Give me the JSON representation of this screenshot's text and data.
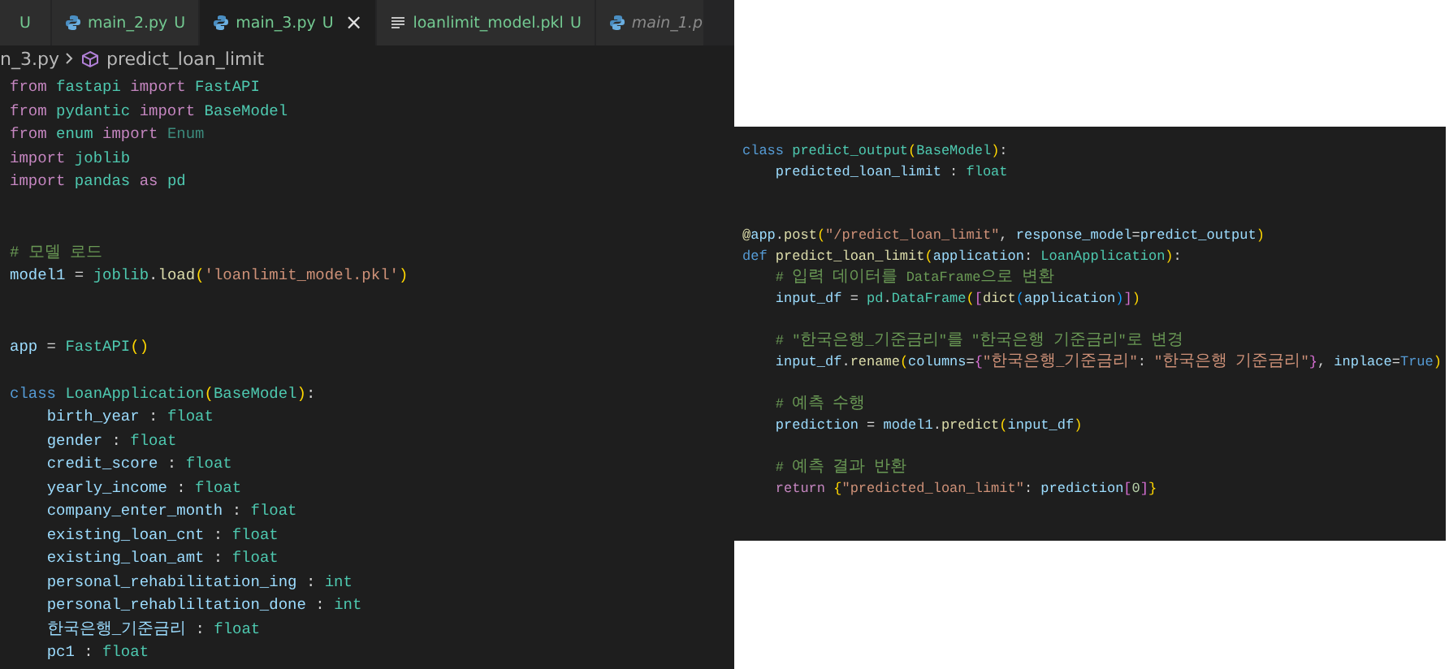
{
  "editor": {
    "tabs": [
      {
        "kind": "partial",
        "badge": "U",
        "selected": false,
        "preview": false
      },
      {
        "kind": "python",
        "label": "main_2.py",
        "badge": "U",
        "selected": false,
        "preview": false
      },
      {
        "kind": "python",
        "label": "main_3.py",
        "badge": "U",
        "selected": true,
        "preview": false,
        "close": "×"
      },
      {
        "kind": "file",
        "label": "loanlimit_model.pkl",
        "badge": "U",
        "selected": false,
        "preview": false
      },
      {
        "kind": "python",
        "label": "main_1.p",
        "selected": false,
        "preview": true
      }
    ],
    "breadcrumb": {
      "file": "n_3.py",
      "symbol": "predict_loan_limit"
    },
    "lines": [
      {
        "tokens": [
          {
            "kind": "kw",
            "text": "from "
          },
          {
            "kind": "mod",
            "text": "fastapi "
          },
          {
            "kind": "kw",
            "text": "import "
          },
          {
            "kind": "cls",
            "text": "FastAPI"
          }
        ]
      },
      {
        "tokens": [
          {
            "kind": "kw",
            "text": "from "
          },
          {
            "kind": "mod",
            "text": "pydantic "
          },
          {
            "kind": "kw",
            "text": "import "
          },
          {
            "kind": "cls",
            "text": "BaseModel"
          }
        ]
      },
      {
        "tokens": [
          {
            "kind": "kw",
            "text": "from "
          },
          {
            "kind": "mod",
            "text": "enum "
          },
          {
            "kind": "kw",
            "text": "import "
          },
          {
            "kind": "dim",
            "text": "Enum"
          }
        ]
      },
      {
        "tokens": [
          {
            "kind": "kw",
            "text": "import "
          },
          {
            "kind": "mod",
            "text": "joblib"
          }
        ]
      },
      {
        "tokens": [
          {
            "kind": "kw",
            "text": "import "
          },
          {
            "kind": "mod",
            "text": "pandas "
          },
          {
            "kind": "kw",
            "text": "as "
          },
          {
            "kind": "mod",
            "text": "pd"
          }
        ]
      },
      {
        "kind": "blank"
      },
      {
        "kind": "blank"
      },
      {
        "tokens": [
          {
            "kind": "com",
            "text": "# 모델 로드"
          }
        ]
      },
      {
        "tokens": [
          {
            "kind": "var",
            "text": "model1"
          },
          {
            "kind": "plain",
            "text": " = "
          },
          {
            "kind": "mod",
            "text": "joblib"
          },
          {
            "kind": "plain",
            "text": "."
          },
          {
            "kind": "fn",
            "text": "load"
          },
          {
            "kind": "p1",
            "text": "("
          },
          {
            "kind": "str",
            "text": "'loanlimit_model.pkl'"
          },
          {
            "kind": "p1",
            "text": ")"
          }
        ]
      },
      {
        "kind": "blank"
      },
      {
        "kind": "blank"
      },
      {
        "tokens": [
          {
            "kind": "var",
            "text": "app"
          },
          {
            "kind": "plain",
            "text": " = "
          },
          {
            "kind": "cls",
            "text": "FastAPI"
          },
          {
            "kind": "p1",
            "text": "()"
          }
        ]
      },
      {
        "kind": "blank"
      },
      {
        "tokens": [
          {
            "kind": "const",
            "text": "class "
          },
          {
            "kind": "cls",
            "text": "LoanApplication"
          },
          {
            "kind": "p1",
            "text": "("
          },
          {
            "kind": "cls",
            "text": "BaseModel"
          },
          {
            "kind": "p1",
            "text": ")"
          },
          {
            "kind": "plain",
            "text": ":"
          }
        ]
      },
      {
        "tokens": [
          {
            "kind": "var",
            "text": "    birth_year"
          },
          {
            "kind": "plain",
            "text": " : "
          },
          {
            "kind": "cls",
            "text": "float"
          }
        ]
      },
      {
        "tokens": [
          {
            "kind": "var",
            "text": "    gender"
          },
          {
            "kind": "plain",
            "text": " : "
          },
          {
            "kind": "cls",
            "text": "float"
          }
        ]
      },
      {
        "tokens": [
          {
            "kind": "var",
            "text": "    credit_score"
          },
          {
            "kind": "plain",
            "text": " : "
          },
          {
            "kind": "cls",
            "text": "float"
          }
        ]
      },
      {
        "tokens": [
          {
            "kind": "var",
            "text": "    yearly_income"
          },
          {
            "kind": "plain",
            "text": " : "
          },
          {
            "kind": "cls",
            "text": "float"
          }
        ]
      },
      {
        "tokens": [
          {
            "kind": "var",
            "text": "    company_enter_month"
          },
          {
            "kind": "plain",
            "text": " : "
          },
          {
            "kind": "cls",
            "text": "float"
          }
        ]
      },
      {
        "tokens": [
          {
            "kind": "var",
            "text": "    existing_loan_cnt"
          },
          {
            "kind": "plain",
            "text": " : "
          },
          {
            "kind": "cls",
            "text": "float"
          }
        ]
      },
      {
        "tokens": [
          {
            "kind": "var",
            "text": "    existing_loan_amt"
          },
          {
            "kind": "plain",
            "text": " : "
          },
          {
            "kind": "cls",
            "text": "float"
          }
        ]
      },
      {
        "tokens": [
          {
            "kind": "var",
            "text": "    personal_rehabilitation_ing"
          },
          {
            "kind": "plain",
            "text": " : "
          },
          {
            "kind": "cls",
            "text": "int"
          }
        ]
      },
      {
        "tokens": [
          {
            "kind": "var",
            "text": "    personal_rehabliltation_done"
          },
          {
            "kind": "plain",
            "text": " : "
          },
          {
            "kind": "cls",
            "text": "int"
          }
        ]
      },
      {
        "tokens": [
          {
            "kind": "var",
            "text": "    한국은행_기준금리"
          },
          {
            "kind": "plain",
            "text": " : "
          },
          {
            "kind": "cls",
            "text": "float"
          }
        ]
      },
      {
        "tokens": [
          {
            "kind": "var",
            "text": "    pc1"
          },
          {
            "kind": "plain",
            "text": " : "
          },
          {
            "kind": "cls",
            "text": "float"
          }
        ]
      }
    ]
  },
  "snippet": {
    "lines": [
      {
        "tokens": [
          {
            "kind": "const",
            "text": "class "
          },
          {
            "kind": "cls",
            "text": "predict_output"
          },
          {
            "kind": "p1",
            "text": "("
          },
          {
            "kind": "cls",
            "text": "BaseModel"
          },
          {
            "kind": "p1",
            "text": ")"
          },
          {
            "kind": "plain",
            "text": ":"
          }
        ]
      },
      {
        "tokens": [
          {
            "kind": "var",
            "text": "    predicted_loan_limit"
          },
          {
            "kind": "plain",
            "text": " : "
          },
          {
            "kind": "cls",
            "text": "float"
          }
        ]
      },
      {
        "kind": "blank"
      },
      {
        "kind": "blank"
      },
      {
        "tokens": [
          {
            "kind": "fn",
            "text": "@"
          },
          {
            "kind": "var",
            "text": "app"
          },
          {
            "kind": "plain",
            "text": "."
          },
          {
            "kind": "fn",
            "text": "post"
          },
          {
            "kind": "p1",
            "text": "("
          },
          {
            "kind": "str",
            "text": "\"/predict_loan_limit\""
          },
          {
            "kind": "plain",
            "text": ", "
          },
          {
            "kind": "var",
            "text": "response_model"
          },
          {
            "kind": "plain",
            "text": "="
          },
          {
            "kind": "var",
            "text": "predict_output"
          },
          {
            "kind": "p1",
            "text": ")"
          }
        ]
      },
      {
        "tokens": [
          {
            "kind": "const",
            "text": "def "
          },
          {
            "kind": "fn",
            "text": "predict_loan_limit"
          },
          {
            "kind": "p1",
            "text": "("
          },
          {
            "kind": "var",
            "text": "application"
          },
          {
            "kind": "plain",
            "text": ": "
          },
          {
            "kind": "cls",
            "text": "LoanApplication"
          },
          {
            "kind": "p1",
            "text": ")"
          },
          {
            "kind": "plain",
            "text": ":"
          }
        ]
      },
      {
        "tokens": [
          {
            "kind": "com",
            "text": "    # 입력 데이터를 DataFrame으로 변환"
          }
        ]
      },
      {
        "tokens": [
          {
            "kind": "var",
            "text": "    input_df"
          },
          {
            "kind": "plain",
            "text": " = "
          },
          {
            "kind": "mod",
            "text": "pd"
          },
          {
            "kind": "plain",
            "text": "."
          },
          {
            "kind": "cls",
            "text": "DataFrame"
          },
          {
            "kind": "p1",
            "text": "("
          },
          {
            "kind": "p2",
            "text": "["
          },
          {
            "kind": "fn",
            "text": "dict"
          },
          {
            "kind": "p3",
            "text": "("
          },
          {
            "kind": "var",
            "text": "application"
          },
          {
            "kind": "p3",
            "text": ")"
          },
          {
            "kind": "p2",
            "text": "]"
          },
          {
            "kind": "p1",
            "text": ")"
          }
        ]
      },
      {
        "kind": "blank"
      },
      {
        "tokens": [
          {
            "kind": "com",
            "text": "    # \"한국은행_기준금리\"를 \"한국은행 기준금리\"로 변경"
          }
        ]
      },
      {
        "tokens": [
          {
            "kind": "var",
            "text": "    input_df"
          },
          {
            "kind": "plain",
            "text": "."
          },
          {
            "kind": "fn",
            "text": "rename"
          },
          {
            "kind": "p1",
            "text": "("
          },
          {
            "kind": "var",
            "text": "columns"
          },
          {
            "kind": "plain",
            "text": "="
          },
          {
            "kind": "p2",
            "text": "{"
          },
          {
            "kind": "str",
            "text": "\"한국은행_기준금리\""
          },
          {
            "kind": "plain",
            "text": ": "
          },
          {
            "kind": "str",
            "text": "\"한국은행 기준금리\""
          },
          {
            "kind": "p2",
            "text": "}"
          },
          {
            "kind": "plain",
            "text": ", "
          },
          {
            "kind": "var",
            "text": "inplace"
          },
          {
            "kind": "plain",
            "text": "="
          },
          {
            "kind": "const",
            "text": "True"
          },
          {
            "kind": "p1",
            "text": ")"
          }
        ]
      },
      {
        "kind": "blank"
      },
      {
        "tokens": [
          {
            "kind": "com",
            "text": "    # 예측 수행"
          }
        ]
      },
      {
        "tokens": [
          {
            "kind": "var",
            "text": "    prediction"
          },
          {
            "kind": "plain",
            "text": " = "
          },
          {
            "kind": "var",
            "text": "model1"
          },
          {
            "kind": "plain",
            "text": "."
          },
          {
            "kind": "fn",
            "text": "predict"
          },
          {
            "kind": "p1",
            "text": "("
          },
          {
            "kind": "var",
            "text": "input_df"
          },
          {
            "kind": "p1",
            "text": ")"
          }
        ]
      },
      {
        "kind": "blank"
      },
      {
        "tokens": [
          {
            "kind": "com",
            "text": "    # 예측 결과 반환"
          }
        ]
      },
      {
        "tokens": [
          {
            "kind": "kw",
            "text": "    return "
          },
          {
            "kind": "p1",
            "text": "{"
          },
          {
            "kind": "str",
            "text": "\"predicted_loan_limit\""
          },
          {
            "kind": "plain",
            "text": ": "
          },
          {
            "kind": "var",
            "text": "prediction"
          },
          {
            "kind": "p2",
            "text": "["
          },
          {
            "kind": "num",
            "text": "0"
          },
          {
            "kind": "p2",
            "text": "]"
          },
          {
            "kind": "p1",
            "text": "}"
          }
        ]
      }
    ]
  }
}
